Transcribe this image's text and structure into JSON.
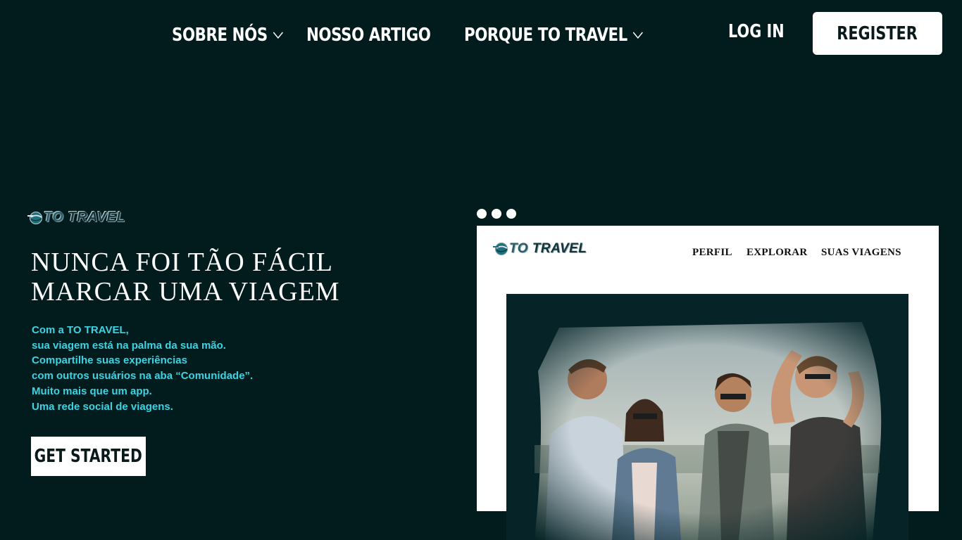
{
  "nav": {
    "items": [
      {
        "label": "SOBRE NÓS",
        "has_dropdown": true
      },
      {
        "label": "NOSSO ARTIGO",
        "has_dropdown": false
      },
      {
        "label": "PORQUE TO TRAVEL",
        "has_dropdown": true
      }
    ],
    "login_label": "LOG IN",
    "register_label": "REGISTER"
  },
  "brand": {
    "logo_text": "TO TRAVEL",
    "logo_icon": "globe-icon"
  },
  "hero": {
    "title_lines": [
      "NUNCA FOI TÃO FÁCIL",
      "MARCAR UMA VIAGEM"
    ],
    "description_lines": [
      "Com a TO TRAVEL,",
      "sua viagem está na palma da sua mão.",
      "Compartilhe suas experiências",
      "com outros usuários na aba “Comunidade”.",
      "Muito mais que um app.",
      "Uma rede social de viagens."
    ],
    "cta_label": "GET STARTED"
  },
  "mockup": {
    "nav_items": [
      "PERFIL",
      "EXPLORAR",
      "SUAS VIAGENS"
    ],
    "photo_subject": "group-of-friends-photo"
  },
  "colors": {
    "background": "#021c1e",
    "accent": "#3ed3e2",
    "text": "#ffffff",
    "button_bg": "#ffffff"
  }
}
